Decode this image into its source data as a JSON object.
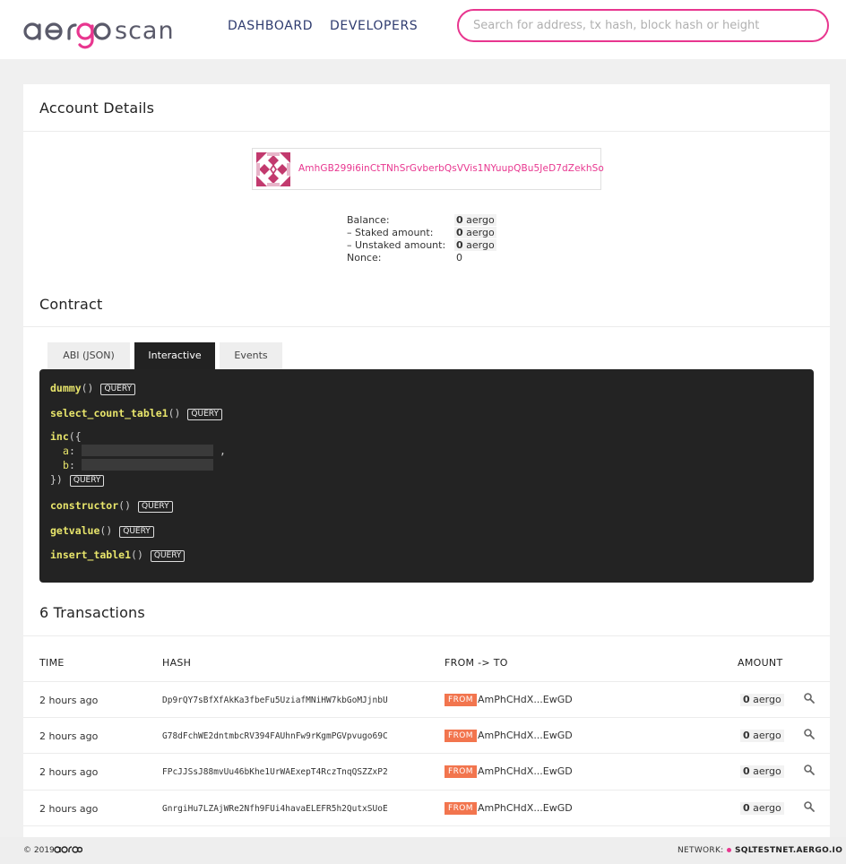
{
  "header": {
    "logo_text": "aergo scan",
    "nav": [
      "DASHBOARD",
      "DEVELOPERS"
    ],
    "search_placeholder": "Search for address, tx hash, block hash or height"
  },
  "account": {
    "title": "Account Details",
    "address": "AmhGB299i6inCtTNhSrGvberbQsVVis1NYuupQBu5JeD7dZekhSo",
    "balance_rows": [
      {
        "label": "Balance:",
        "amount": "0",
        "unit": "aergo"
      },
      {
        "label": "– Staked amount:",
        "amount": "0",
        "unit": "aergo"
      },
      {
        "label": "– Unstaked amount:",
        "amount": "0",
        "unit": "aergo"
      }
    ],
    "nonce_label": "Nonce:",
    "nonce_value": "0"
  },
  "contract": {
    "title": "Contract",
    "tabs": [
      "ABI (JSON)",
      "Interactive",
      "Events"
    ],
    "active_tab": "Interactive",
    "query_label": "QUERY",
    "functions": [
      {
        "name": "dummy",
        "suffix": "()"
      },
      {
        "name": "select_count_table1",
        "suffix": "()"
      },
      {
        "name": "inc",
        "open": "({",
        "params": [
          "a",
          "b"
        ],
        "close": "})"
      },
      {
        "name": "constructor",
        "suffix": "()"
      },
      {
        "name": "getvalue",
        "suffix": "()"
      },
      {
        "name": "insert_table1",
        "suffix": "()"
      }
    ]
  },
  "transactions": {
    "title": "6 Transactions",
    "columns": [
      "TIME",
      "HASH",
      "FROM -> TO",
      "AMOUNT"
    ],
    "rows": [
      {
        "time": "2 hours ago",
        "hash": "Dp9rQY7sBfXfAkKa3fbeFu5UziafMNiHW7kbGoMJjnbU",
        "badge": "FROM",
        "addr": "AmPhCHdX...EwGD",
        "amount": "0",
        "unit": "aergo"
      },
      {
        "time": "2 hours ago",
        "hash": "G78dFchWE2dntmbcRV394FAUhnFw9rKgmPGVpvugo69C",
        "badge": "FROM",
        "addr": "AmPhCHdX...EwGD",
        "amount": "0",
        "unit": "aergo"
      },
      {
        "time": "2 hours ago",
        "hash": "FPcJJSsJ88mvUu46bKhe1UrWAExepT4RczTnqQSZZxP2",
        "badge": "FROM",
        "addr": "AmPhCHdX...EwGD",
        "amount": "0",
        "unit": "aergo"
      },
      {
        "time": "2 hours ago",
        "hash": "GnrgiHu7LZAjWRe2Nfh9FUi4havaELEFR5h2QutxSUoE",
        "badge": "FROM",
        "addr": "AmPhCHdX...EwGD",
        "amount": "0",
        "unit": "aergo"
      }
    ]
  },
  "footer": {
    "copyright": "© 2019",
    "network_label": "NETWORK:",
    "network_value": "SQLTESTNET.AERGO.IO"
  },
  "colors": {
    "accent": "#e8368f",
    "from_badge": "#f2754e",
    "code_bg": "#232323",
    "nav_text": "#2e3b6f"
  }
}
